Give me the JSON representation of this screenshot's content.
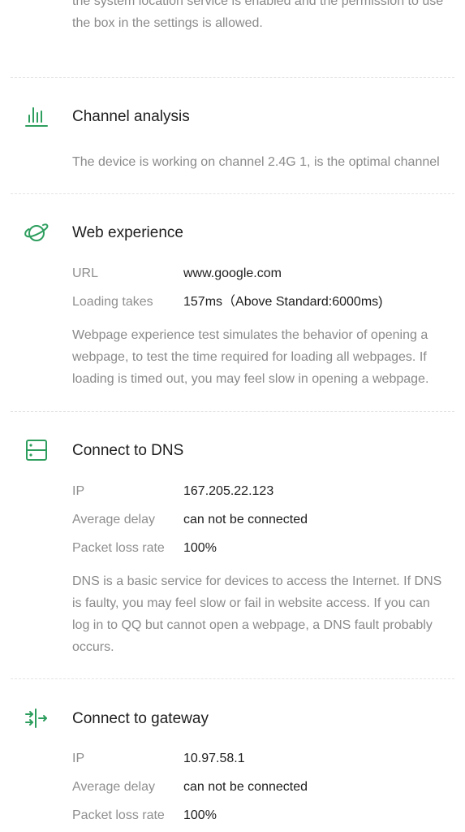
{
  "location_note": {
    "text": "the system location service is enabled and the permission to use the box in the settings is allowed."
  },
  "channel": {
    "icon": "bar-chart-icon",
    "title": "Channel analysis",
    "description": "The device is working on channel 2.4G 1, is the optimal channel"
  },
  "web": {
    "icon": "planet-icon",
    "title": "Web experience",
    "url_label": "URL",
    "url_value": "www.google.com",
    "loading_label": "Loading takes",
    "loading_value": "157ms（Above Standard:6000ms)",
    "description": "Webpage experience test simulates the behavior of opening a webpage, to test the time required for loading all webpages. If loading is timed out, you may feel slow in opening a webpage."
  },
  "dns": {
    "icon": "server-icon",
    "title": "Connect to DNS",
    "ip_label": "IP",
    "ip_value": "167.205.22.123",
    "delay_label": "Average delay",
    "delay_value": "can not be connected",
    "loss_label": "Packet loss rate",
    "loss_value": "100%",
    "description": "DNS is a basic service for devices to access the Internet. If DNS is faulty, you may feel slow or fail in website access. If you can log in to QQ but cannot open a webpage, a DNS fault probably occurs."
  },
  "gateway": {
    "icon": "gateway-arrows-icon",
    "title": "Connect to gateway",
    "ip_label": "IP",
    "ip_value": "10.97.58.1",
    "delay_label": "Average delay",
    "delay_value": "can not be connected",
    "loss_label": "Packet loss rate",
    "loss_value": "100%"
  },
  "colors": {
    "accent": "#2e9e5e",
    "text_primary": "#1e1e1e",
    "text_secondary": "#8a8a8a",
    "divider": "#e3e3e3"
  }
}
